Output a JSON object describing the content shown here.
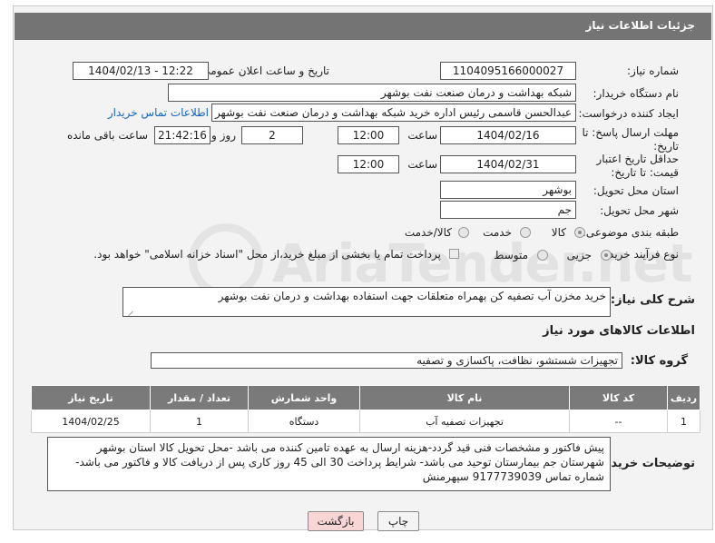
{
  "header": {
    "title": "جزئیات اطلاعات نیاز"
  },
  "watermark": {
    "text": "AriaTender.net"
  },
  "fields": {
    "need_number_label": "شماره نیاز:",
    "need_number": "1104095166000027",
    "announce_label": "تاریخ و ساعت اعلان عمومی:",
    "announce_value": "1404/02/13 - 12:22",
    "buyer_org_label": "نام دستگاه خریدار:",
    "buyer_org": "شبکه بهداشت و درمان صنعت نفت بوشهر",
    "creator_label": "ایجاد کننده درخواست:",
    "creator": "عبدالحسن قاسمی رئیس اداره خرید  شبکه بهداشت و درمان صنعت نفت بوشهر",
    "contact_link": "اطلاعات تماس خریدار",
    "reply_deadline_label": "مهلت ارسال پاسخ: تا تاریخ:",
    "reply_date": "1404/02/16",
    "time_label": "ساعت",
    "reply_time": "12:00",
    "days_value": "2",
    "days_label": "روز و",
    "remaining_time": "21:42:16",
    "remaining_label": "ساعت باقی مانده",
    "price_validity_label": "حداقل تاریخ اعتبار قیمت: تا تاریخ:",
    "price_date": "1404/02/31",
    "price_time": "12:00",
    "province_label": "استان محل تحویل:",
    "province": "بوشهر",
    "city_label": "شهر محل تحویل:",
    "city": "جم",
    "category_label": "طبقه بندی موضوعی:",
    "category_options": [
      "کالا",
      "خدمت",
      "کالا/خدمت"
    ],
    "process_label": "نوع فرآیند خرید :",
    "process_options": [
      "جزیی",
      "متوسط"
    ],
    "payment_note": "پرداخت تمام یا بخشی از مبلغ خرید،از محل \"اسناد خزانه اسلامی\" خواهد بود.",
    "summary_label": "شرح کلی نیاز:",
    "summary": "خرید مخزن آب تصفیه کن بهمراه متعلقات جهت استفاده بهداشت و درمان نفت بوشهر",
    "goods_info_title": "اطلاعات کالاهای مورد نیاز",
    "goods_group_label": "گروه کالا:",
    "goods_group": "تجهیزات شستشو، نظافت، پاکسازی و تصفیه"
  },
  "table": {
    "headers": [
      "ردیف",
      "کد کالا",
      "نام کالا",
      "واحد شمارش",
      "تعداد / مقدار",
      "تاریخ نیاز"
    ],
    "rows": [
      [
        "1",
        "--",
        "تجهیزات تصفیه آب",
        "دستگاه",
        "1",
        "1404/02/25"
      ]
    ]
  },
  "buyer_notes_label": "توضیحات خریدار:",
  "buyer_notes": "پیش فاکتور و مشخصات فنی قید گردد-هزینه ارسال به عهده تامین کننده می باشد -محل تحویل کالا استان بوشهر شهرستان جم بیمارستان توحید می باشد- شرایط پرداخت 30 الی 45 روز کاری پس از دریافت کالا و فاکتور می باشد-شماره تماس 9177739039 سپهرمنش",
  "buttons": {
    "print": "چاپ",
    "back": "بازگشت"
  },
  "colors": {
    "titlebar": "#747474",
    "back_button": "#f9d6d6",
    "link": "#1565c0"
  }
}
